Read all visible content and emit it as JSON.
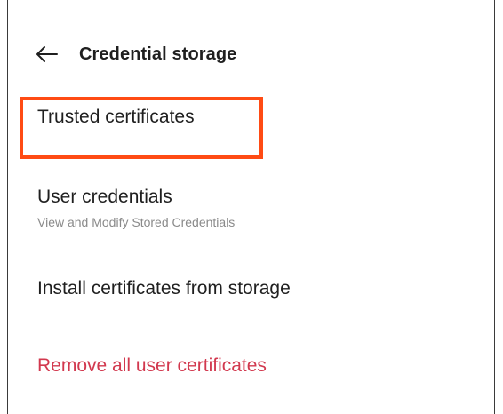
{
  "header": {
    "back_icon": "arrow-left-icon",
    "title": "Credential storage"
  },
  "items": [
    {
      "label": "Trusted certificates",
      "highlighted": true
    },
    {
      "label": "User credentials",
      "subtitle": "View and Modify Stored Credentials"
    },
    {
      "label": "Install certificates from storage"
    },
    {
      "label": "Remove all user certificates",
      "color": "#d2384e"
    }
  ],
  "colors": {
    "highlight": "#ff4b14",
    "danger": "#d2384e",
    "text": "#1f1f1f",
    "subtext": "#8a8a8a"
  }
}
